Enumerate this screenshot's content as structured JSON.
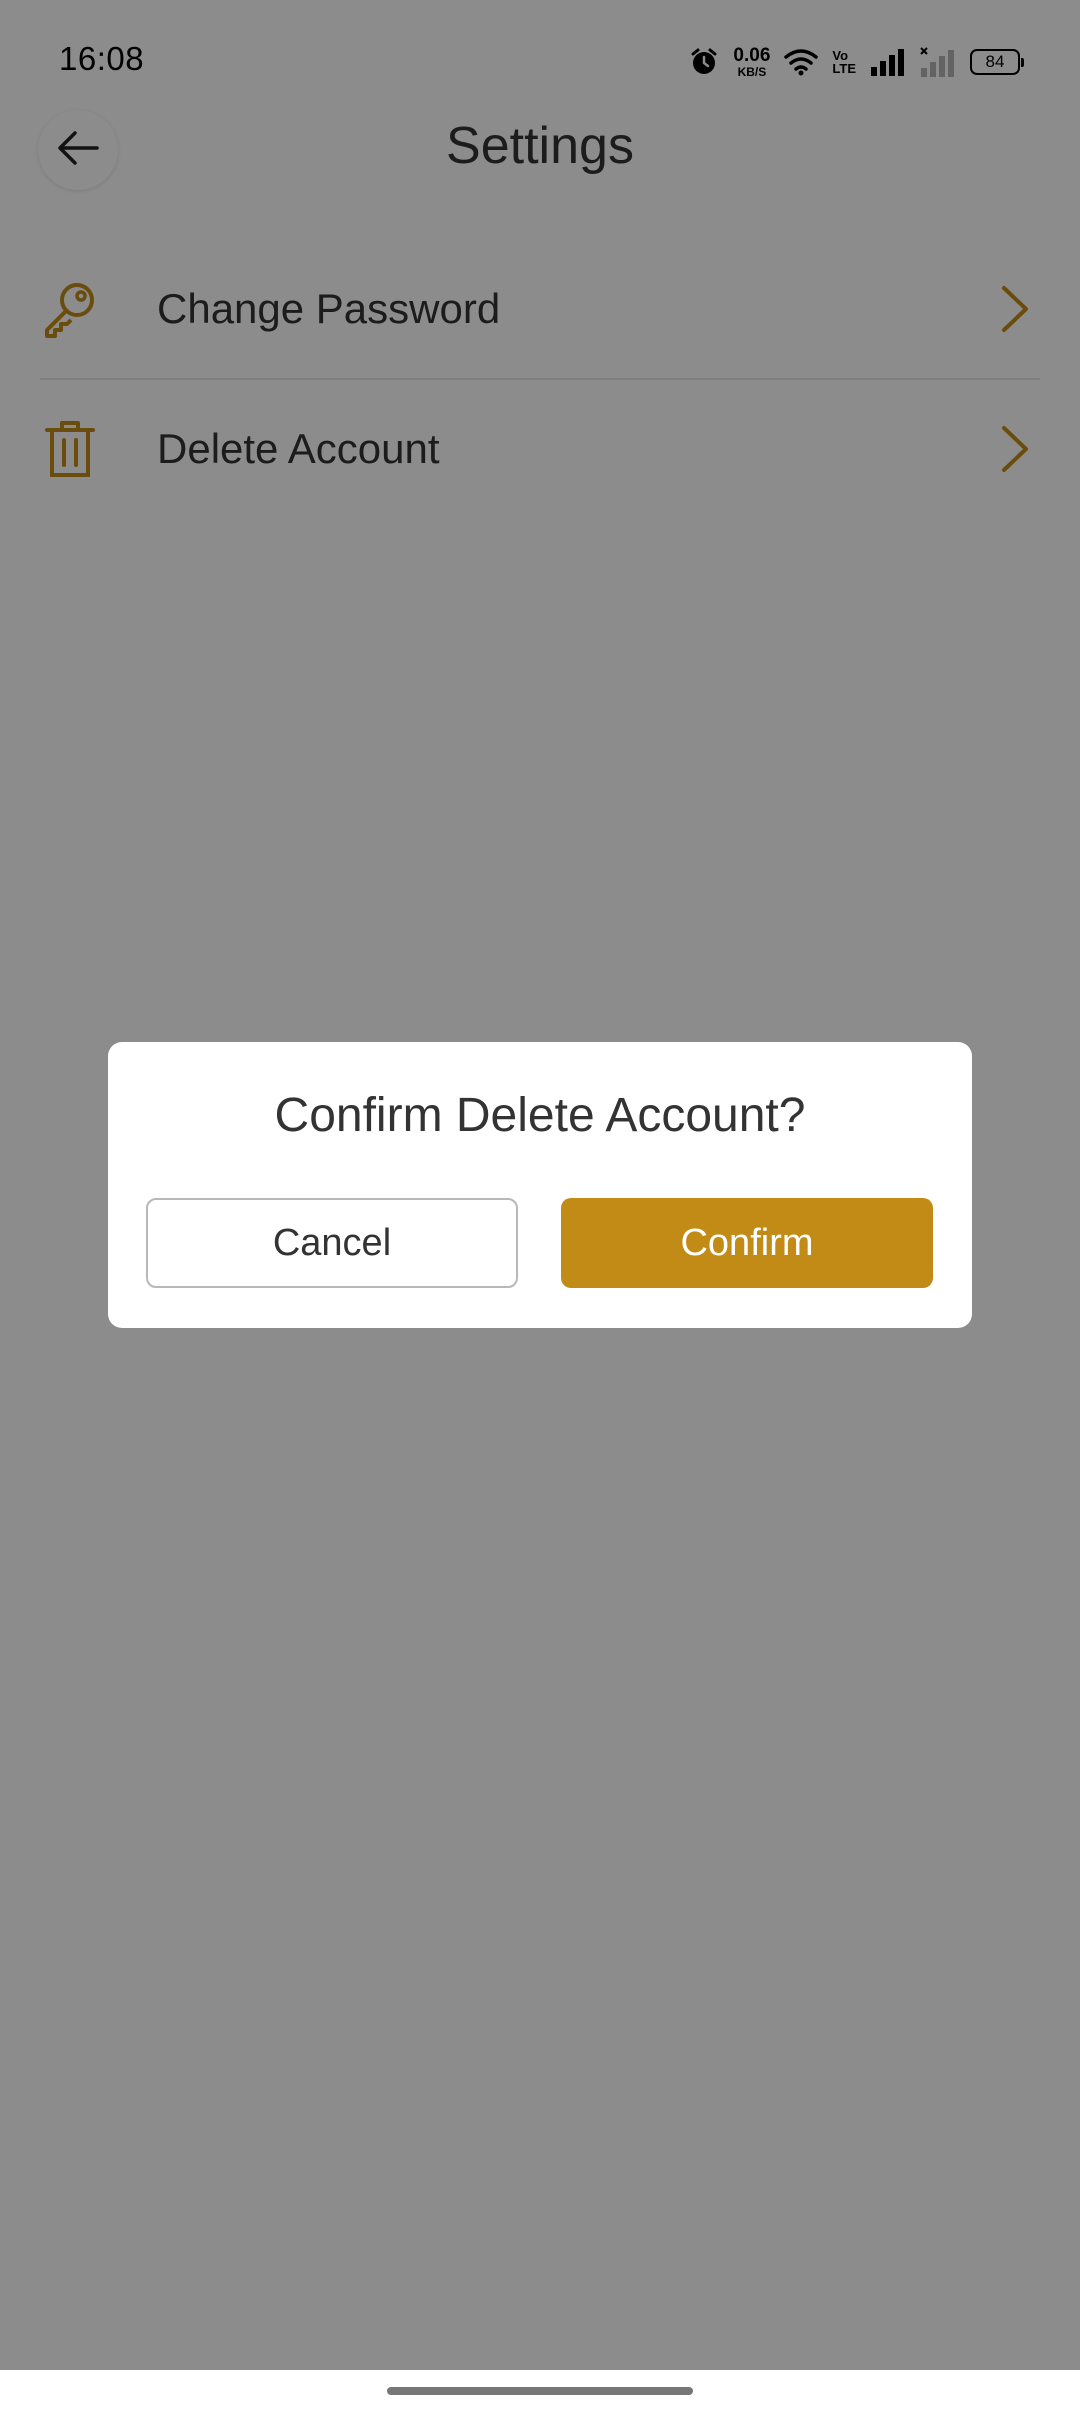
{
  "status_bar": {
    "time": "16:08",
    "net_speed_value": "0.06",
    "net_speed_unit": "KB/S",
    "volte_top": "Vo",
    "volte_bottom": "LTE",
    "battery": "84",
    "icons": [
      "alarm-icon",
      "wifi-icon",
      "volte-icon",
      "signal-icon",
      "signal-no-service-icon",
      "battery-icon"
    ]
  },
  "header": {
    "title": "Settings",
    "back_icon": "arrow-left-icon"
  },
  "settings": {
    "items": [
      {
        "label": "Change Password",
        "icon": "key-icon"
      },
      {
        "label": "Delete Account",
        "icon": "trash-icon"
      }
    ]
  },
  "dialog": {
    "title": "Confirm Delete Account?",
    "cancel_label": "Cancel",
    "confirm_label": "Confirm"
  },
  "colors": {
    "accent": "#c28b16",
    "overlay": "rgba(0,0,0,0.45)",
    "text": "#333333"
  }
}
